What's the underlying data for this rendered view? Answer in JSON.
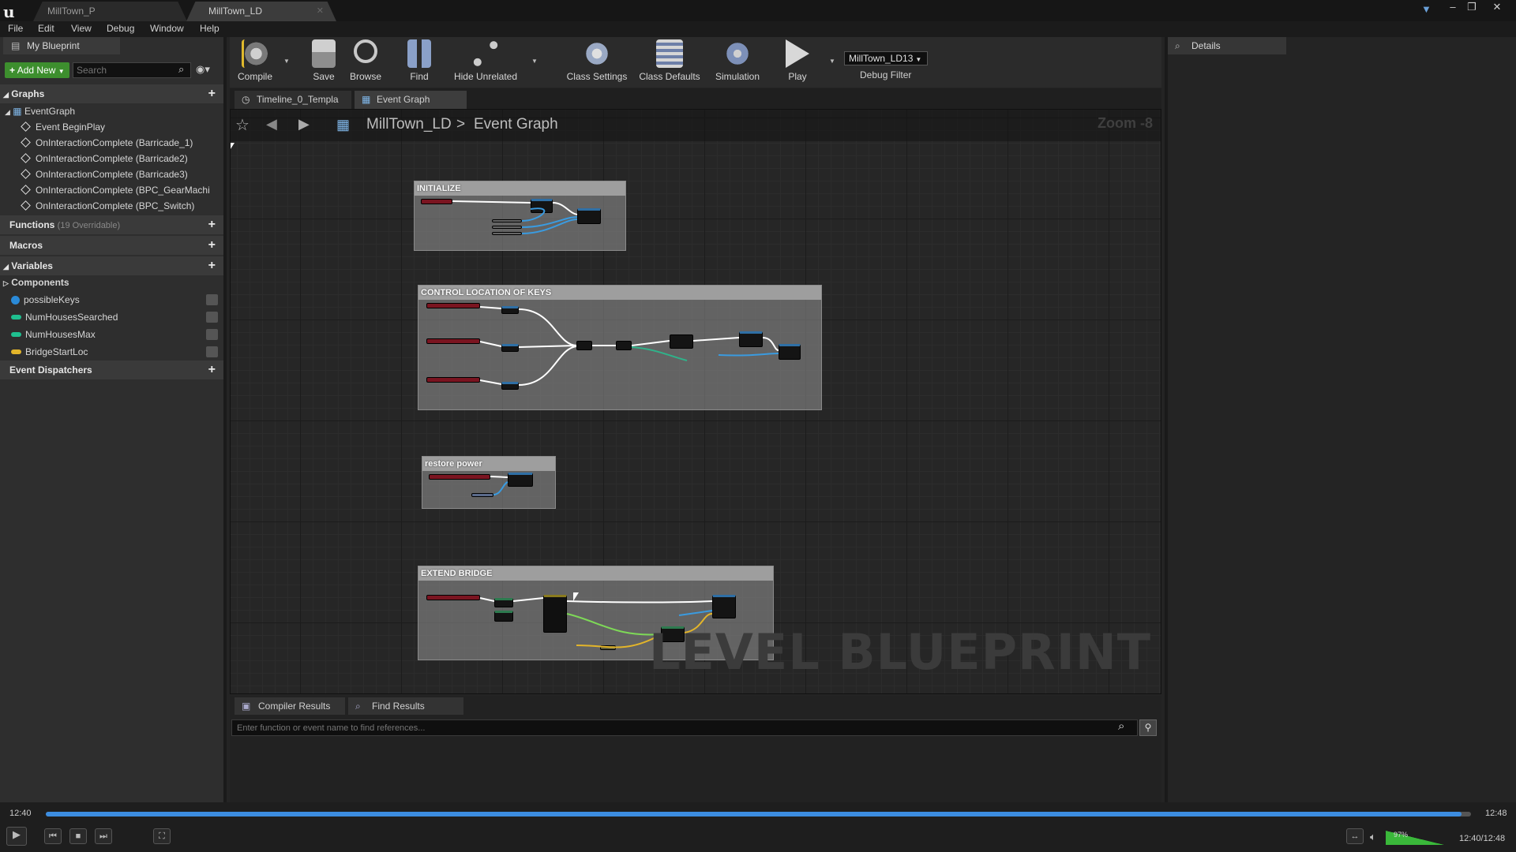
{
  "titlebar": {
    "tabs": [
      "MillTown_P",
      "MillTown_LD"
    ],
    "active_tab": 1
  },
  "menu": [
    "File",
    "Edit",
    "View",
    "Debug",
    "Window",
    "Help"
  ],
  "left_panel": {
    "tab": "My Blueprint",
    "add_new": "Add New",
    "search_placeholder": "Search",
    "graphs_label": "Graphs",
    "event_graph": "EventGraph",
    "events": [
      "Event BeginPlay",
      "OnInteractionComplete (Barricade_1)",
      "OnInteractionComplete (Barricade2)",
      "OnInteractionComplete (Barricade3)",
      "OnInteractionComplete (BPC_GearMachi",
      "OnInteractionComplete (BPC_Switch)"
    ],
    "functions_label": "Functions",
    "functions_sub": "(19 Overridable)",
    "macros_label": "Macros",
    "variables_label": "Variables",
    "components_label": "Components",
    "variables": [
      {
        "name": "possibleKeys",
        "color": "#2a8ad8"
      },
      {
        "name": "NumHousesSearched",
        "color": "#1fbf8f"
      },
      {
        "name": "NumHousesMax",
        "color": "#1fbf8f"
      },
      {
        "name": "BridgeStartLoc",
        "color": "#e3b52a"
      }
    ],
    "dispatchers_label": "Event Dispatchers"
  },
  "toolbar": {
    "compile": "Compile",
    "save": "Save",
    "browse": "Browse",
    "find": "Find",
    "hide_unrelated": "Hide Unrelated",
    "class_settings": "Class Settings",
    "class_defaults": "Class Defaults",
    "simulation": "Simulation",
    "play": "Play",
    "debug_select": "MillTown_LD13",
    "debug_filter": "Debug Filter"
  },
  "graph_tabs": [
    "Timeline_0_Templa",
    "Event Graph"
  ],
  "breadcrumb": {
    "level": "MillTown_LD",
    "graph": "Event Graph"
  },
  "zoom": "Zoom -8",
  "comments": [
    "INITIALIZE",
    "CONTROL LOCATION OF KEYS",
    "restore power",
    "EXTEND BRIDGE"
  ],
  "watermark": "LEVEL BLUEPRINT",
  "details_tab": "Details",
  "bottom_tabs": [
    "Compiler Results",
    "Find Results"
  ],
  "find_placeholder": "Enter function or event name to find references...",
  "player": {
    "time_left": "12:40",
    "time_right": "12:48",
    "time_total": "12:40/12:48",
    "volume": "97%",
    "progress": 0.9935
  }
}
